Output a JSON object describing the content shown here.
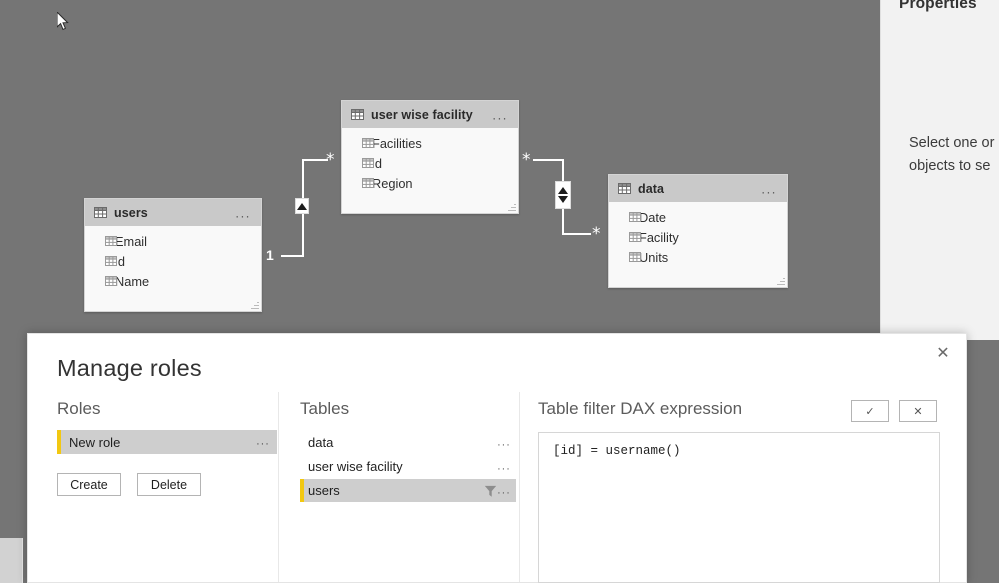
{
  "app": {
    "canvas_bg": "#757575",
    "accent_yellow": "#f2c811"
  },
  "properties_pane": {
    "title": "Properties",
    "empty_line1": "Select one or",
    "empty_line2": "objects to se"
  },
  "model_tables": [
    {
      "name": "users",
      "icon": "table-grid-icon",
      "menu": "...",
      "fields": [
        "Email",
        "id",
        "Name"
      ]
    },
    {
      "name": "user wise facility",
      "icon": "table-grid-icon",
      "menu": "...",
      "fields": [
        "Facilities",
        "id",
        "Region"
      ]
    },
    {
      "name": "data",
      "icon": "table-grid-icon",
      "menu": "...",
      "fields": [
        "Date",
        "Facility",
        "Units"
      ]
    }
  ],
  "relationships": [
    {
      "from_table": "users",
      "to_table": "user wise facility",
      "from_cardinality": "1",
      "to_cardinality": "*",
      "cross_filter": "single"
    },
    {
      "from_table": "user wise facility",
      "to_table": "data",
      "from_cardinality": "*",
      "to_cardinality": "*",
      "cross_filter": "both"
    }
  ],
  "dialog": {
    "title": "Manage roles",
    "close_label": "✕",
    "roles": {
      "heading": "Roles",
      "items": [
        {
          "label": "New role",
          "selected": true,
          "menu": "..."
        }
      ],
      "create_label": "Create",
      "delete_label": "Delete"
    },
    "tables": {
      "heading": "Tables",
      "items": [
        {
          "label": "data",
          "selected": false,
          "filtered": false,
          "menu": "..."
        },
        {
          "label": "user wise facility",
          "selected": false,
          "filtered": false,
          "menu": "..."
        },
        {
          "label": "users",
          "selected": true,
          "filtered": true,
          "menu": "..."
        }
      ]
    },
    "dax": {
      "heading": "Table filter DAX expression",
      "accept_label": "✓",
      "cancel_label": "✕",
      "expression": "[id] = username()"
    }
  }
}
